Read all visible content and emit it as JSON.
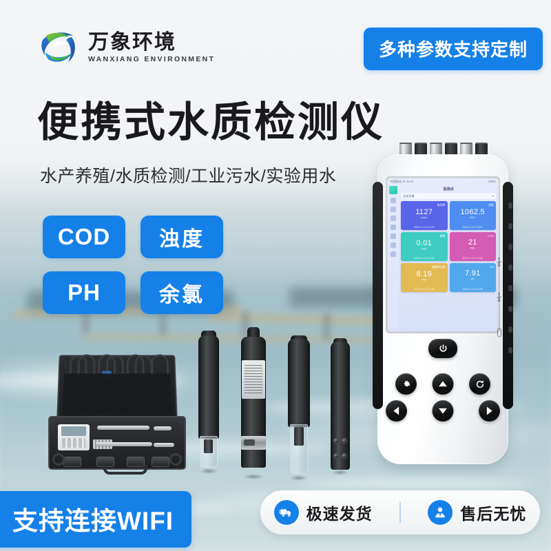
{
  "brand": {
    "logo_icon": "globe-swirl-logo-icon",
    "name_cn": "万象环境",
    "name_en": "WANXIANG ENVIRONMENT"
  },
  "top_badge": {
    "label": "多种参数支持定制"
  },
  "headline": {
    "title": "便携式水质检测仪",
    "subtitle": "水产养殖/水质检测/工业污水/实验用水"
  },
  "feature_tags": [
    {
      "label": "COD",
      "cjk": false
    },
    {
      "label": "浊度",
      "cjk": true
    },
    {
      "label": "PH",
      "cjk": false
    },
    {
      "label": "余氯",
      "cjk": true
    }
  ],
  "device": {
    "screen": {
      "statusbar_left": "中国移动 令 11:47",
      "statusbar_right": "100%",
      "title": "监测点",
      "selector_value": "全部设备",
      "selector_icon": "chevron-down-icon",
      "tiles": [
        {
          "name": "电导率",
          "value": "1127",
          "unit": "us/cm",
          "time": "2024-11-14 17:14:09",
          "color": "#5866e8"
        },
        {
          "name": "浊度",
          "value": "1062.5",
          "unit": "NTU",
          "time": "2024-11-14 17:09:01",
          "color": "#4f8df0"
        },
        {
          "name": "氨氮",
          "value": "0.01",
          "unit": "mg/L",
          "time": "2024-11-14 17:13:38",
          "color": "#3ecdc0"
        },
        {
          "name": "COD",
          "value": "21",
          "unit": "mg/L",
          "time": "2024-11-14 17:13:46",
          "color": "#d45bb4"
        },
        {
          "name": "溶解氧含量",
          "value": "8.19",
          "unit": "mg/L",
          "time": "2024-11-14 17:15:44",
          "color": "#e3bb55"
        },
        {
          "name": "PH",
          "value": "7.91",
          "unit": "pH",
          "time": "2024-11-14 17:12:38",
          "color": "#52a8ec"
        }
      ]
    },
    "buttons": [
      {
        "name": "power-button",
        "icon": "power-icon"
      },
      {
        "name": "settings-button",
        "icon": "gear-icon"
      },
      {
        "name": "up-button",
        "icon": "triangle-up-icon"
      },
      {
        "name": "refresh-button",
        "icon": "refresh-icon"
      },
      {
        "name": "left-button",
        "icon": "triangle-left-icon"
      },
      {
        "name": "down-button",
        "icon": "triangle-down-icon"
      },
      {
        "name": "right-button",
        "icon": "triangle-right-icon"
      }
    ],
    "side_ports": [
      "usb-port-icon",
      "usb-port-icon",
      "connector-port-icon"
    ]
  },
  "wifi_banner": {
    "label": "支持连接WIFI"
  },
  "services": [
    {
      "icon": "delivery-truck-icon",
      "label": "极速发货"
    },
    {
      "icon": "customer-service-person-icon",
      "label": "售后无忧"
    }
  ],
  "colors": {
    "accent_blue": "#1580e8",
    "logo_green": "#52b848",
    "logo_blue": "#1b4f9c",
    "text_dark": "#1a1a1c"
  }
}
